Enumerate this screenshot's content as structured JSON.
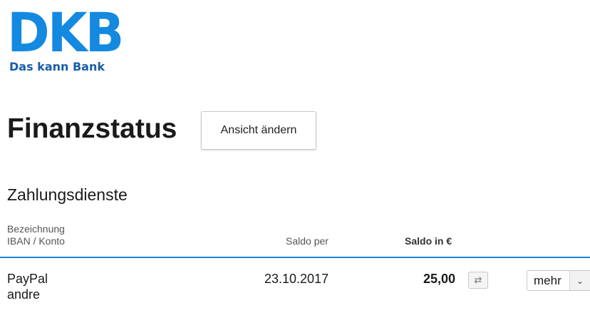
{
  "brand": {
    "logo_text": "DKB",
    "tagline": "Das kann Bank",
    "primary_color": "#1489e0",
    "tagline_color": "#1a5ea8"
  },
  "page": {
    "title": "Finanzstatus",
    "view_button_label": "Ansicht ändern"
  },
  "section": {
    "title": "Zahlungsdienste",
    "columns": {
      "name": "Bezeichnung",
      "iban": "IBAN / Konto",
      "saldo_per": "Saldo per",
      "saldo_eur": "Saldo in €"
    },
    "rows": [
      {
        "name": "PayPal",
        "sub": "andre",
        "date": "23.10.2017",
        "amount": "25,00",
        "transfer_icon": "transfer-arrows-icon",
        "more_label": "mehr"
      }
    ],
    "accent_line_color": "#1a82d8"
  }
}
